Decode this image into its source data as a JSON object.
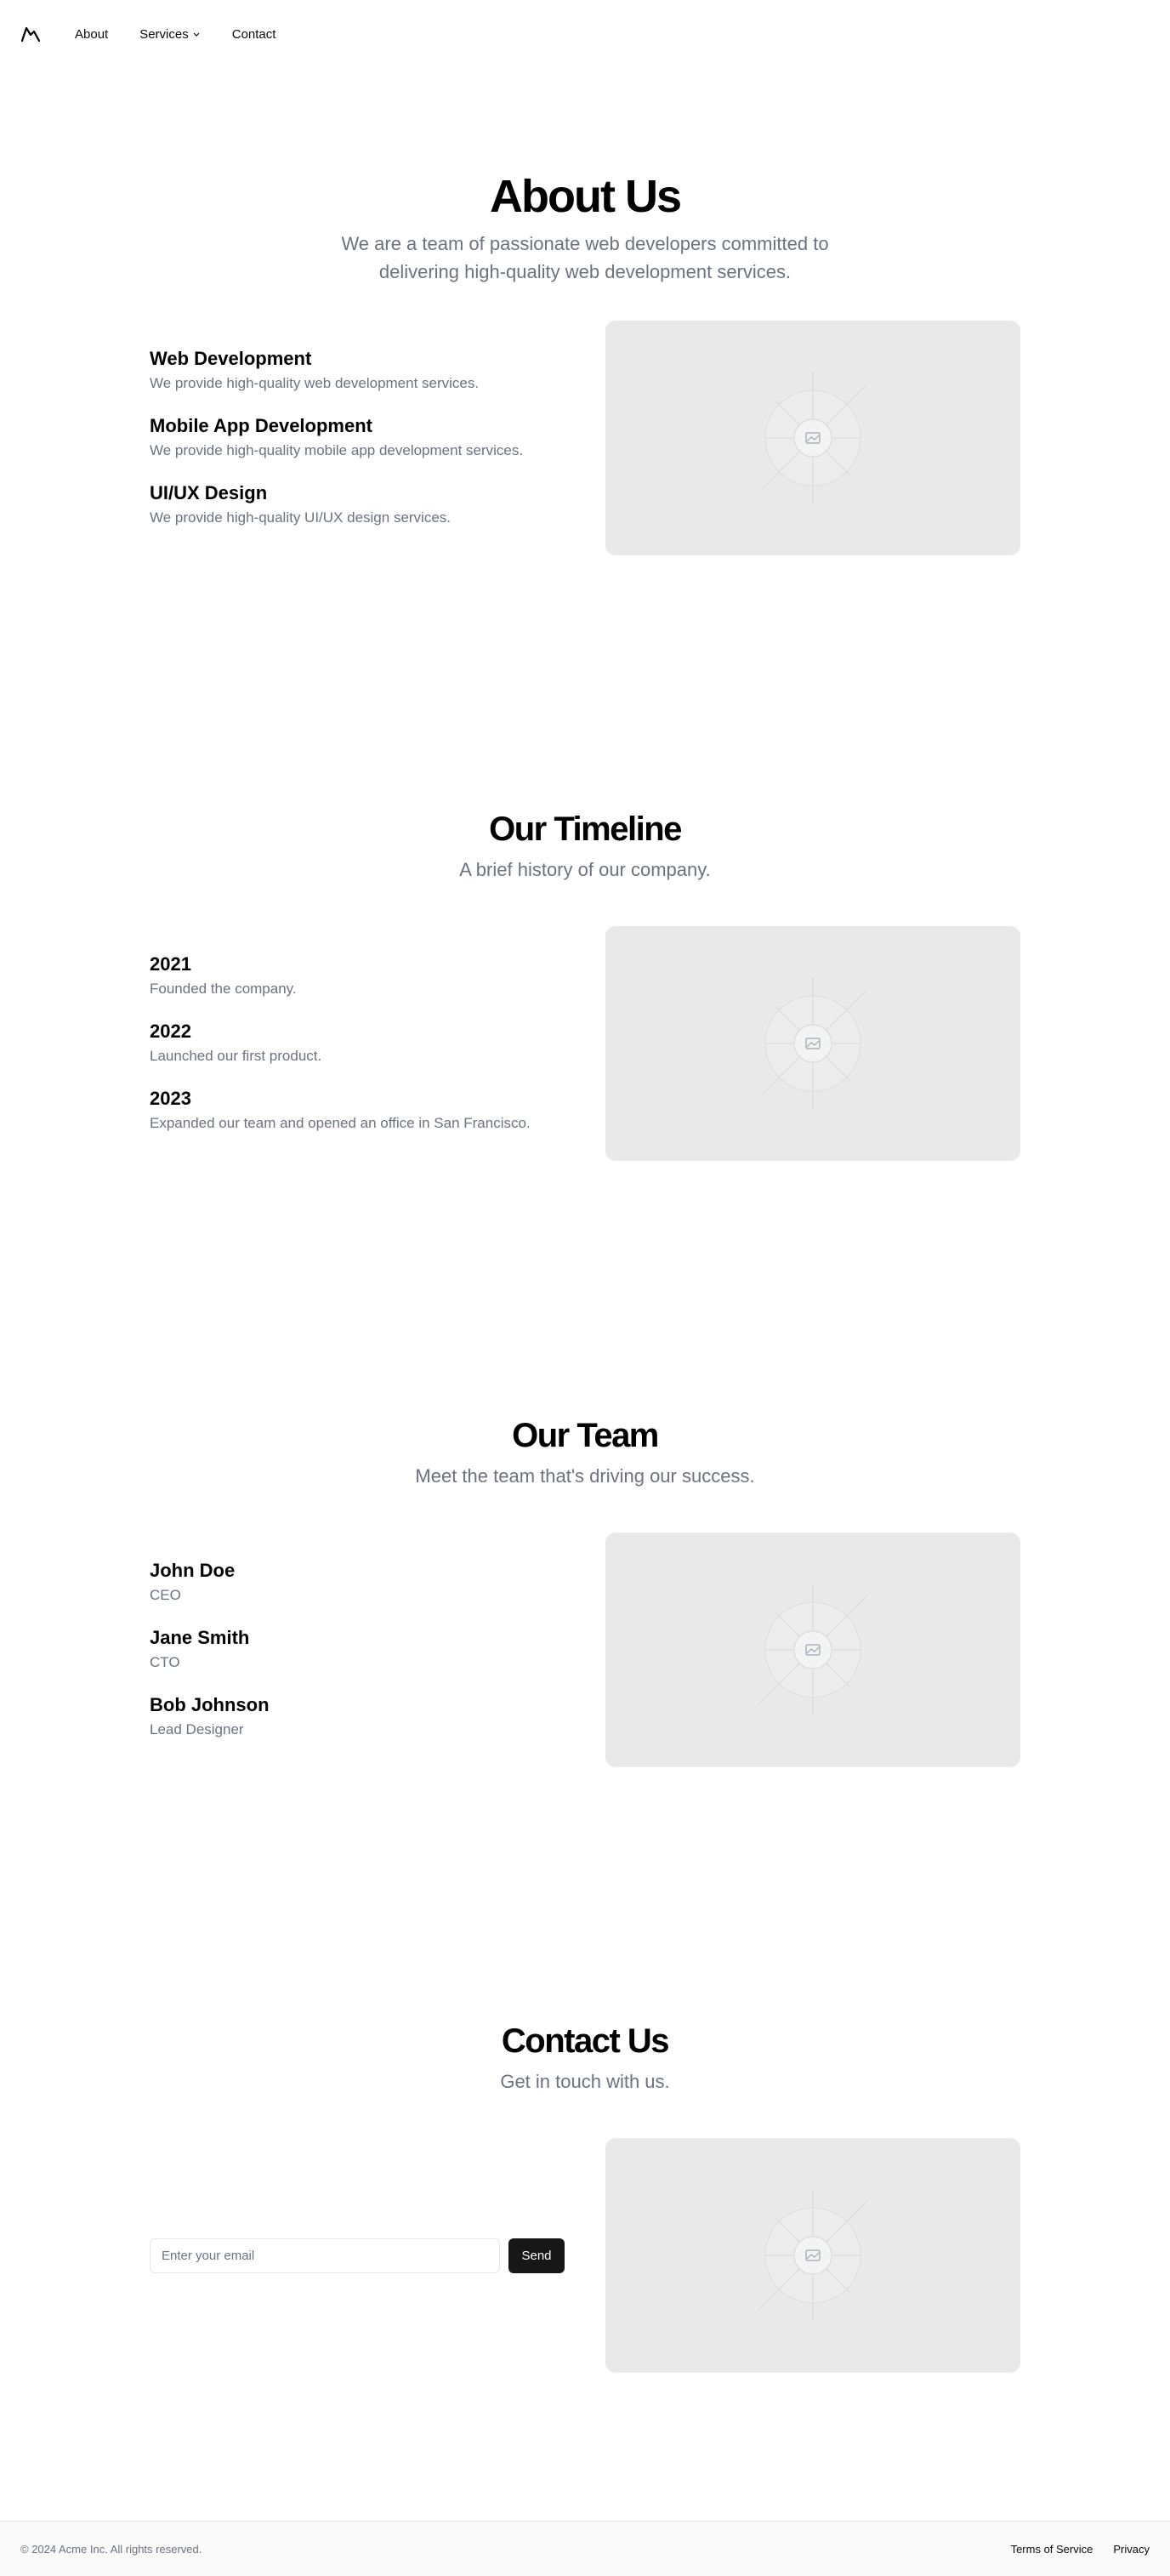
{
  "header": {
    "logo_icon": "mountain-logo-icon",
    "nav": [
      {
        "label": "About"
      },
      {
        "label": "Services"
      },
      {
        "label": "Contact"
      }
    ]
  },
  "about": {
    "title": "About Us",
    "subtitle": "We are a team of passionate web developers committed to delivering high-quality web development services.",
    "items": [
      {
        "title": "Web Development",
        "desc": "We provide high-quality web development services."
      },
      {
        "title": "Mobile App Development",
        "desc": "We provide high-quality mobile app development services."
      },
      {
        "title": "UI/UX Design",
        "desc": "We provide high-quality UI/UX design services."
      }
    ]
  },
  "timeline": {
    "title": "Our Timeline",
    "subtitle": "A brief history of our company.",
    "items": [
      {
        "title": "2021",
        "desc": "Founded the company."
      },
      {
        "title": "2022",
        "desc": "Launched our first product."
      },
      {
        "title": "2023",
        "desc": "Expanded our team and opened an office in San Francisco."
      }
    ]
  },
  "team": {
    "title": "Our Team",
    "subtitle": "Meet the team that's driving our success.",
    "items": [
      {
        "title": "John Doe",
        "desc": "CEO"
      },
      {
        "title": "Jane Smith",
        "desc": "CTO"
      },
      {
        "title": "Bob Johnson",
        "desc": "Lead Designer"
      }
    ]
  },
  "contact": {
    "title": "Contact Us",
    "subtitle": "Get in touch with us.",
    "email_placeholder": "Enter your email",
    "email_value": "",
    "send_label": "Send"
  },
  "footer": {
    "copyright": "© 2024 Acme Inc. All rights reserved.",
    "links": [
      {
        "label": "Terms of Service"
      },
      {
        "label": "Privacy"
      }
    ]
  },
  "colors": {
    "muted_text": "#6b7280",
    "placeholder_bg": "#e9e9e9",
    "button_bg": "#171717"
  }
}
